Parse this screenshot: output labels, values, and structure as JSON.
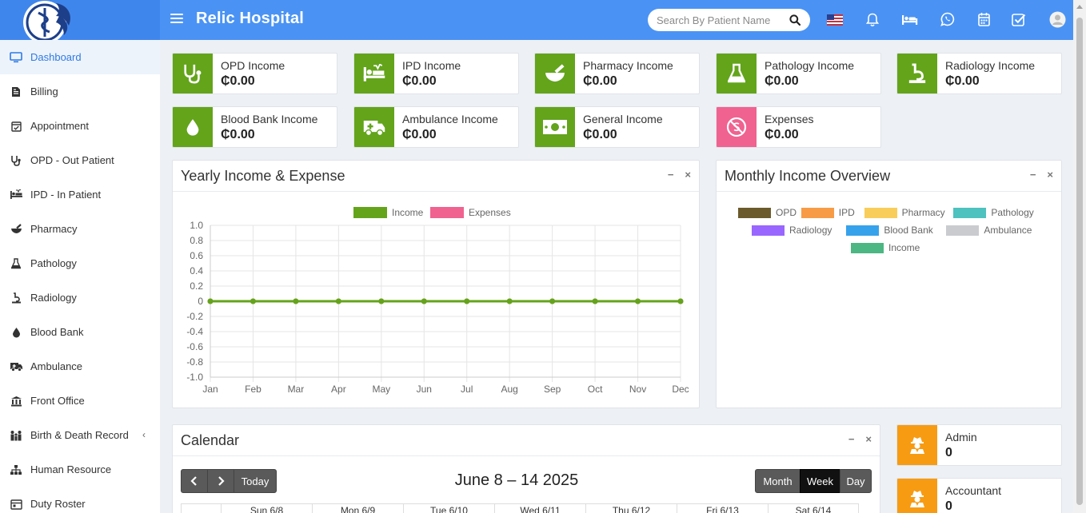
{
  "header": {
    "app_title": "Relic Hospital",
    "search_placeholder": "Search By Patient Name",
    "icons": [
      "menu-icon",
      "flag-us-icon",
      "bell-icon",
      "bed-icon",
      "whatsapp-icon",
      "calendar-icon",
      "task-check-icon",
      "user-avatar-icon"
    ]
  },
  "sidebar": {
    "items": [
      {
        "label": "Dashboard",
        "icon": "monitor-icon"
      },
      {
        "label": "Billing",
        "icon": "file-invoice-icon"
      },
      {
        "label": "Appointment",
        "icon": "calendar-check-icon"
      },
      {
        "label": "OPD - Out Patient",
        "icon": "stethoscope-icon"
      },
      {
        "label": "IPD - In Patient",
        "icon": "procedures-icon"
      },
      {
        "label": "Pharmacy",
        "icon": "mortar-pestle-icon"
      },
      {
        "label": "Pathology",
        "icon": "flask-icon"
      },
      {
        "label": "Radiology",
        "icon": "x-ray-icon"
      },
      {
        "label": "Blood Bank",
        "icon": "tint-icon"
      },
      {
        "label": "Ambulance",
        "icon": "ambulance-icon"
      },
      {
        "label": "Front Office",
        "icon": "building-icon"
      },
      {
        "label": "Birth & Death Record",
        "icon": "family-icon"
      },
      {
        "label": "Human Resource",
        "icon": "sitemap-icon"
      },
      {
        "label": "Duty Roster",
        "icon": "roster-icon"
      }
    ]
  },
  "income_boxes": [
    {
      "label": "OPD Income",
      "value": "₵0.00",
      "color": "#63a41b",
      "icon": "stethoscope-icon"
    },
    {
      "label": "IPD Income",
      "value": "₵0.00",
      "color": "#63a41b",
      "icon": "procedures-icon"
    },
    {
      "label": "Pharmacy Income",
      "value": "₵0.00",
      "color": "#63a41b",
      "icon": "mortar-pestle-icon"
    },
    {
      "label": "Pathology Income",
      "value": "₵0.00",
      "color": "#63a41b",
      "icon": "flask-icon"
    },
    {
      "label": "Radiology Income",
      "value": "₵0.00",
      "color": "#63a41b",
      "icon": "x-ray-icon"
    },
    {
      "label": "Blood Bank Income",
      "value": "₵0.00",
      "color": "#63a41b",
      "icon": "tint-icon"
    },
    {
      "label": "Ambulance Income",
      "value": "₵0.00",
      "color": "#63a41b",
      "icon": "ambulance-icon"
    },
    {
      "label": "General Income",
      "value": "₵0.00",
      "color": "#63a41b",
      "icon": "money-bill-icon"
    },
    {
      "label": "Expenses",
      "value": "₵0.00",
      "color": "#f06290",
      "icon": "no-money-icon"
    }
  ],
  "yearly_panel": {
    "title": "Yearly Income & Expense"
  },
  "monthly_panel": {
    "title": "Monthly Income Overview"
  },
  "chart_data": [
    {
      "type": "line",
      "title": "Yearly Income & Expense",
      "categories": [
        "Jan",
        "Feb",
        "Mar",
        "Apr",
        "May",
        "Jun",
        "Jul",
        "Aug",
        "Sep",
        "Oct",
        "Nov",
        "Dec"
      ],
      "series": [
        {
          "name": "Income",
          "color": "#63a41b",
          "values": [
            0,
            0,
            0,
            0,
            0,
            0,
            0,
            0,
            0,
            0,
            0,
            0
          ]
        },
        {
          "name": "Expenses",
          "color": "#f06290",
          "values": [
            0,
            0,
            0,
            0,
            0,
            0,
            0,
            0,
            0,
            0,
            0,
            0
          ]
        }
      ],
      "yticks": [
        "1.0",
        "0.8",
        "0.6",
        "0.4",
        "0.2",
        "0",
        "-0.2",
        "-0.4",
        "-0.6",
        "-0.8",
        "-1.0"
      ],
      "ylim": [
        -1,
        1
      ],
      "grid": true,
      "legend": "top-center"
    },
    {
      "type": "pie",
      "title": "Monthly Income Overview",
      "series": [
        {
          "name": "OPD",
          "color": "#6b5a2b"
        },
        {
          "name": "IPD",
          "color": "#f79b47"
        },
        {
          "name": "Pharmacy",
          "color": "#f9cd5a"
        },
        {
          "name": "Pathology",
          "color": "#4dc2bf"
        },
        {
          "name": "Radiology",
          "color": "#9966ff"
        },
        {
          "name": "Blood Bank",
          "color": "#36a2eb"
        },
        {
          "name": "Ambulance",
          "color": "#c9cbcf"
        },
        {
          "name": "Income",
          "color": "#4cb782"
        }
      ],
      "values": [],
      "legend": "top"
    }
  ],
  "calendar": {
    "title": "Calendar",
    "range": "June 8 – 14 2025",
    "today_label": "Today",
    "views": [
      "Month",
      "Week",
      "Day"
    ],
    "active_view": "Week",
    "days": [
      "Sun 6/8",
      "Mon 6/9",
      "Tue 6/10",
      "Wed 6/11",
      "Thu 6/12",
      "Fri 6/13",
      "Sat 6/14"
    ]
  },
  "staff_boxes": [
    {
      "label": "Admin",
      "value": "0",
      "color": "#f79b12",
      "icon": "user-secret-icon"
    },
    {
      "label": "Accountant",
      "value": "0",
      "color": "#f79b12",
      "icon": "user-secret-icon"
    }
  ],
  "panel_tools": {
    "minimize": "−",
    "close": "×"
  }
}
